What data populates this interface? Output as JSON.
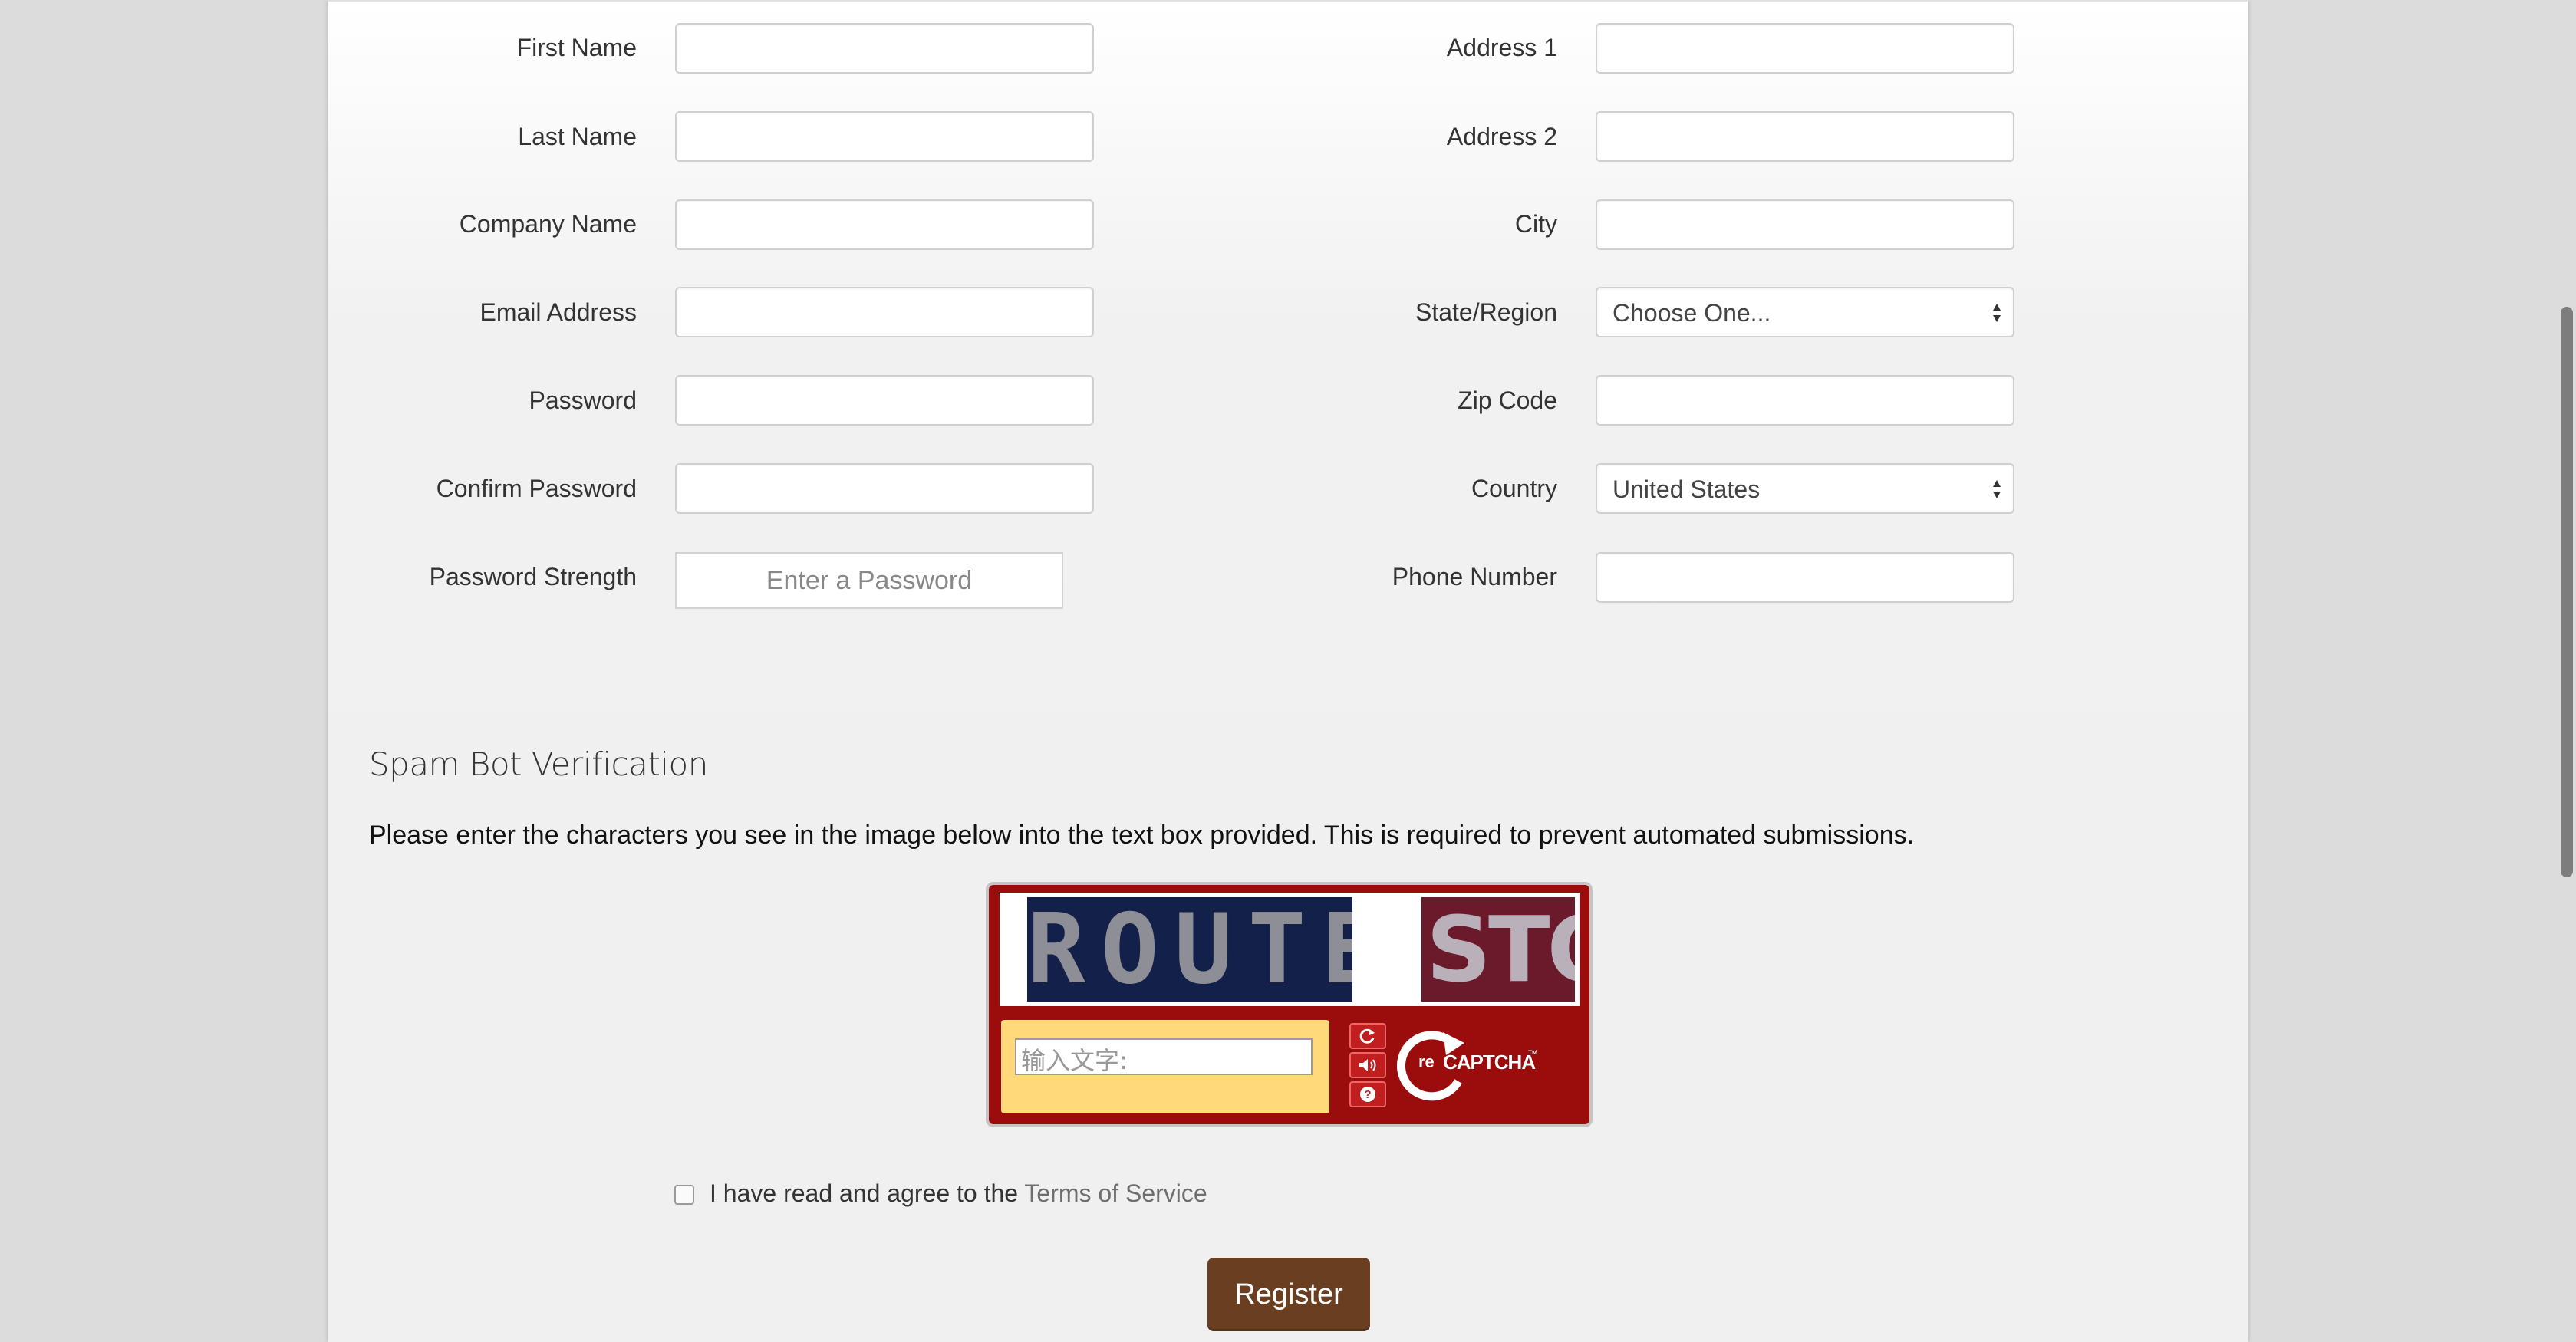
{
  "left_fields": [
    {
      "label": "First Name",
      "value": ""
    },
    {
      "label": "Last Name",
      "value": ""
    },
    {
      "label": "Company Name",
      "value": ""
    },
    {
      "label": "Email Address",
      "value": ""
    },
    {
      "label": "Password",
      "value": ""
    },
    {
      "label": "Confirm Password",
      "value": ""
    }
  ],
  "password_strength": {
    "label": "Password Strength",
    "indicator_text": "Enter a Password"
  },
  "right_fields": [
    {
      "label": "Address 1",
      "value": ""
    },
    {
      "label": "Address 2",
      "value": ""
    },
    {
      "label": "City",
      "value": ""
    },
    {
      "label": "State/Region",
      "selected": "Choose One..."
    },
    {
      "label": "Zip Code",
      "value": ""
    },
    {
      "label": "Country",
      "selected": "United States"
    },
    {
      "label": "Phone Number",
      "value": ""
    }
  ],
  "spam": {
    "title": "Spam Bot Verification",
    "instructions": "Please enter the characters you see in the image below into the text box provided. This is required to prevent automated submissions."
  },
  "captcha": {
    "word1": "ROUTE",
    "word2": "STOP",
    "input_placeholder": "输入文字:",
    "logo_text": "CAPTCHA",
    "logo_prefix": "re",
    "tm": "™"
  },
  "terms": {
    "prefix": "I have read and agree to the ",
    "link": "Terms of Service",
    "checked": false
  },
  "register_label": "Register"
}
